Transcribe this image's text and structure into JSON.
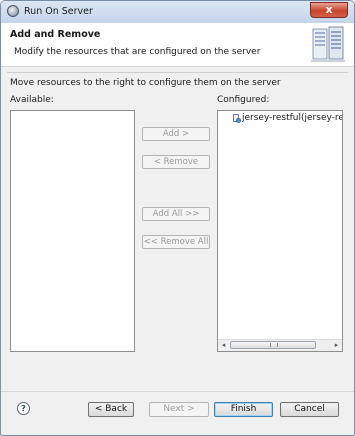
{
  "window": {
    "title": "Run On Server",
    "close_glyph": "x"
  },
  "header": {
    "title": "Add and Remove",
    "description": "Modify the resources that are configured on the server",
    "icon": "server-wizard-banner-icon"
  },
  "instructions": "Move resources to the right to configure them on the server",
  "available": {
    "label": "Available:",
    "items": []
  },
  "configured": {
    "label": "Configured:",
    "items": [
      {
        "label": "jersey-restful(jersey-res",
        "icon": "web-module-icon"
      }
    ]
  },
  "transfer_buttons": {
    "add": "Add >",
    "remove": "< Remove",
    "add_all": "Add All >>",
    "remove_all": "<< Remove All"
  },
  "footer": {
    "help_glyph": "?",
    "back": "< Back",
    "next": "Next >",
    "finish": "Finish",
    "cancel": "Cancel"
  }
}
